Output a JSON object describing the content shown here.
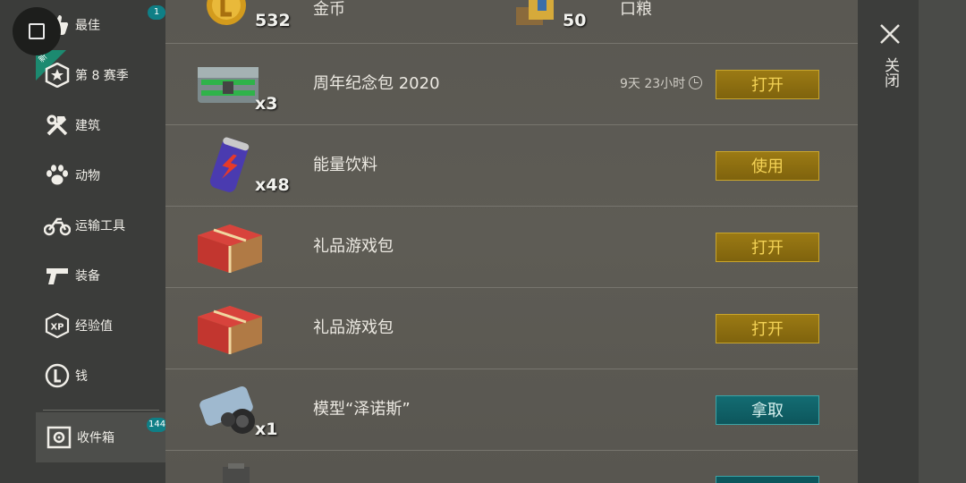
{
  "sidebar": {
    "items": [
      {
        "label": "最佳",
        "icon": "thumbs-up-icon",
        "badge": "1"
      },
      {
        "label": "第 8 赛季",
        "icon": "season-star-badge-icon",
        "ribbon": "新"
      },
      {
        "label": "建筑",
        "icon": "hammer-wrench-icon"
      },
      {
        "label": "动物",
        "icon": "paw-icon"
      },
      {
        "label": "运输工具",
        "icon": "motorcycle-icon"
      },
      {
        "label": "装备",
        "icon": "pistol-icon"
      },
      {
        "label": "经验值",
        "icon": "xp-badge-icon",
        "icon_text": "XP"
      },
      {
        "label": "钱",
        "icon": "coin-icon"
      },
      {
        "label": "收件箱",
        "icon": "safe-icon",
        "badge": "144"
      }
    ]
  },
  "top_row": {
    "left": {
      "qty": "532",
      "name": "金币",
      "icon": "gold-coin-icon"
    },
    "right": {
      "qty": "50",
      "name": "口粮",
      "icon": "ration-box-icon"
    }
  },
  "rows": [
    {
      "name": "周年纪念包 2020",
      "qty": "x3",
      "icon": "metal-crate-icon",
      "timer": "9天 23小时",
      "button": "打开",
      "button_style": "gold"
    },
    {
      "name": "能量饮料",
      "qty": "x48",
      "icon": "energy-drink-can-icon",
      "button": "使用",
      "button_style": "gold"
    },
    {
      "name": "礼品游戏包",
      "qty": "",
      "icon": "gift-box-icon",
      "button": "打开",
      "button_style": "gold"
    },
    {
      "name": "礼品游戏包",
      "qty": "",
      "icon": "gift-box-icon",
      "button": "打开",
      "button_style": "gold"
    },
    {
      "name": "模型“泽诺斯”",
      "qty": "x1",
      "icon": "model-kit-icon",
      "button": "拿取",
      "button_style": "teal"
    }
  ],
  "right_panel": {
    "close_label": "关闭"
  },
  "colors": {
    "gold_button": "#8c6e10",
    "teal_button": "#106068",
    "badge": "#0f7f86"
  }
}
